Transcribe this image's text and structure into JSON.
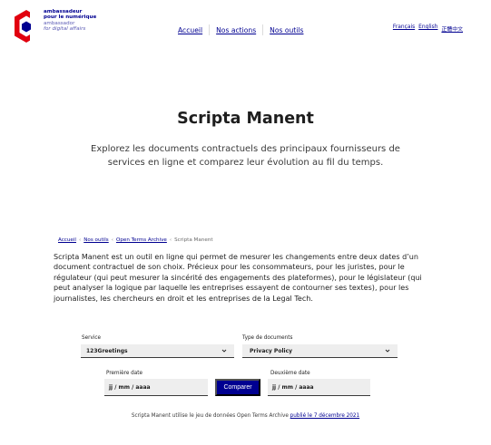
{
  "brand": {
    "line1": "ambassadeur",
    "line2": "pour le numérique",
    "line3": "ambassador",
    "line4": "for digital affairs",
    "color_primary": "#000091",
    "color_accent": "#e1000f"
  },
  "nav": {
    "items": [
      "Accueil",
      "Nos actions",
      "Nos outils"
    ]
  },
  "languages": [
    "Français",
    "English",
    "正體中文"
  ],
  "hero": {
    "title": "Scripta Manent",
    "subtitle": "Explorez les documents contractuels des principaux fournisseurs de services en ligne et comparez leur évolution au fil du temps."
  },
  "breadcrumb": {
    "items": [
      "Accueil",
      "Nos outils",
      "Open Terms Archive"
    ],
    "current": "Scripta Manent",
    "separator": "‹"
  },
  "intro": "Scripta Manent est un outil en ligne qui permet de mesurer les changements entre deux dates d’un document contractuel de son choix. Précieux pour les consommateurs, pour les juristes, pour le régulateur (qui peut mesurer la sincérité des engagements des plateformes), pour le législateur (qui peut analyser la logique par laquelle les entreprises essayent de contourner ses textes), pour les journalistes, les chercheurs en droit et les entreprises de la Legal Tech.",
  "form": {
    "service_label": "Service",
    "service_value": "123Greetings",
    "doctype_label": "Type de documents",
    "doctype_value": "Privacy Policy",
    "date1_label": "Première date",
    "date1_value": "jj / mm / aaaa",
    "date2_label": "Deuxième date",
    "date2_value": "jj / mm / aaaa",
    "submit_label": "Comparer"
  },
  "footnote": {
    "text": "Scripta Manent utilise le jeu de données Open Terms Archive",
    "link": "publié le 7 décembre 2021"
  }
}
